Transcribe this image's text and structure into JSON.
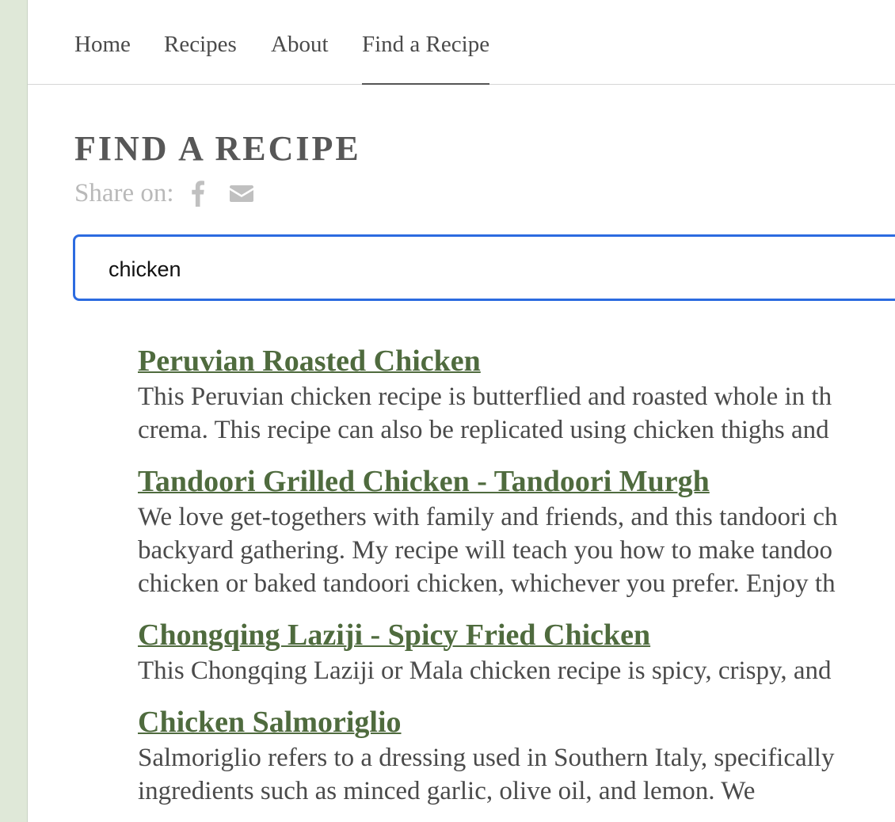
{
  "nav": {
    "items": [
      {
        "label": "Home"
      },
      {
        "label": "Recipes"
      },
      {
        "label": "About"
      },
      {
        "label": "Find a Recipe",
        "active": true
      }
    ]
  },
  "page": {
    "title": "FIND A RECIPE",
    "share_label": "Share on:",
    "share_icons": [
      "facebook-icon",
      "email-icon"
    ]
  },
  "search": {
    "value": "chicken"
  },
  "results": [
    {
      "title": "Peruvian Roasted Chicken",
      "lines": [
        "This Peruvian chicken recipe is butterflied and roasted whole in th",
        "crema. This recipe can also be replicated using chicken thighs and"
      ]
    },
    {
      "title": "Tandoori Grilled Chicken - Tandoori Murgh",
      "lines": [
        "We love get-togethers with family and friends, and this tandoori ch",
        "backyard gathering. My recipe will teach you how to make tandoo",
        "chicken or baked tandoori chicken, whichever you prefer. Enjoy th"
      ]
    },
    {
      "title": "Chongqing Laziji - Spicy Fried Chicken",
      "lines": [
        "This Chongqing Laziji or Mala chicken recipe is spicy, crispy, and"
      ]
    },
    {
      "title": "Chicken Salmoriglio",
      "lines": [
        "Salmoriglio refers to a dressing used in Southern Italy, specifically",
        "ingredients such as minced garlic, olive oil, and lemon. We"
      ]
    }
  ],
  "colors": {
    "link_green": "#4f6b3e",
    "focus_blue": "#2c6be0",
    "sidebar_green": "#dfe8d8"
  }
}
